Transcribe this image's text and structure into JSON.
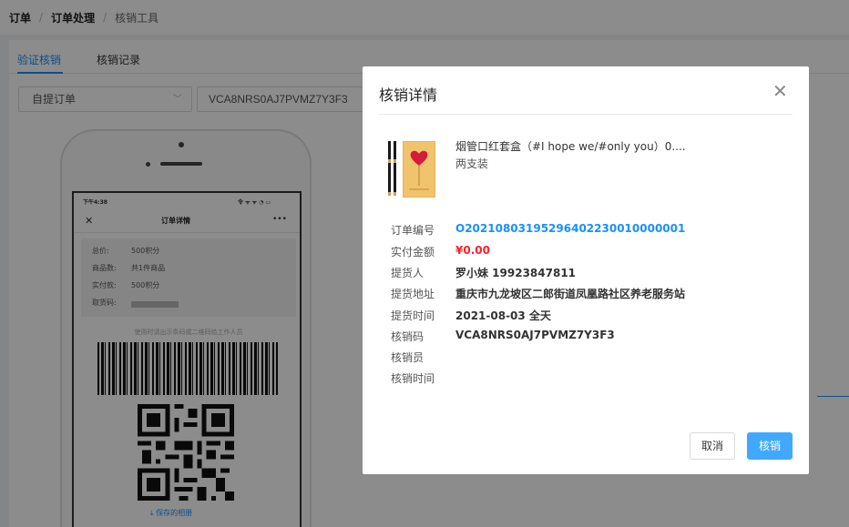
{
  "breadcrumb": {
    "level1": "订单",
    "level2": "订单处理",
    "level3": "核销工具",
    "separator": "/"
  },
  "tabs": [
    {
      "label": "验证核销",
      "active": true
    },
    {
      "label": "核销记录",
      "active": false
    }
  ],
  "filter": {
    "order_type": "自提订单",
    "verify_code_value": "VCA8NRS0AJ7PVMZ7Y3F3"
  },
  "phone_preview": {
    "status_left": "下午4:38",
    "status_right": "令 ᯤ ᯤ ◔ ▭",
    "close_symbol": "✕",
    "title": "订单详情",
    "more_symbol": "•••",
    "rows": [
      {
        "label": "总价:",
        "value": "500积分"
      },
      {
        "label": "商品数:",
        "value": "共1件商品"
      },
      {
        "label": "实付款:",
        "value": "500积分"
      },
      {
        "label": "取货码:",
        "value": ""
      }
    ],
    "hint": "使用时请出示条码或二维码给工作人员",
    "save_label": "保存的相册",
    "save_icon_glyph": "⤓"
  },
  "modal": {
    "title": "核销详情",
    "close_symbol": "✕",
    "product": {
      "name": "烟管口红套盒（#I hope we/#only you）0....",
      "spec": "两支装"
    },
    "fields": [
      {
        "label": "订单编号",
        "value": "O20210803195296402230010000001",
        "style": "blue"
      },
      {
        "label": "实付金额",
        "value": "¥0.00",
        "style": "red"
      },
      {
        "label": "提货人",
        "value": "罗小妹 19923847811",
        "style": "normal"
      },
      {
        "label": "提货地址",
        "value": "重庆市九龙坡区二郎街道凤凰路社区养老服务站",
        "style": "normal"
      },
      {
        "label": "提货时间",
        "value": "2021-08-03 全天",
        "style": "normal"
      },
      {
        "label": "核销码",
        "value": "VCA8NRS0AJ7PVMZ7Y3F3",
        "style": "normal"
      },
      {
        "label": "核销员",
        "value": "",
        "style": "normal"
      },
      {
        "label": "核销时间",
        "value": "",
        "style": "normal"
      }
    ],
    "cancel_label": "取消",
    "confirm_label": "核销"
  },
  "colors": {
    "primary": "#1890ff",
    "button": "#40a9ff",
    "price_red": "#f5222d"
  },
  "icons": {
    "close": "close-icon",
    "dropdown": "chevron-down-icon",
    "save": "download-icon"
  }
}
